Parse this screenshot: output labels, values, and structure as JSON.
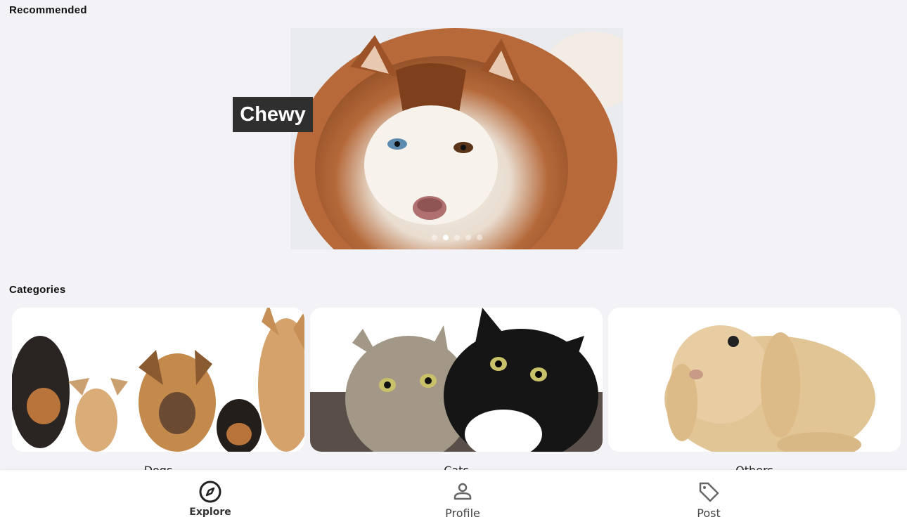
{
  "recommended": {
    "title": "Recommended",
    "carousel": {
      "caption": "Chewy",
      "dot_count": 5,
      "active_dot": 1
    }
  },
  "categories": {
    "title": "Categories",
    "items": [
      {
        "label": "Dogs"
      },
      {
        "label": "Cats"
      },
      {
        "label": "Others"
      }
    ]
  },
  "nav": {
    "items": [
      {
        "label": "Explore",
        "icon": "compass-icon",
        "active": true
      },
      {
        "label": "Profile",
        "icon": "person-icon",
        "active": false
      },
      {
        "label": "Post",
        "icon": "tag-icon",
        "active": false
      }
    ]
  },
  "colors": {
    "background": "#f2f2f7",
    "caption_bg": "#2f2f2f",
    "nav_bg": "#ffffff"
  }
}
